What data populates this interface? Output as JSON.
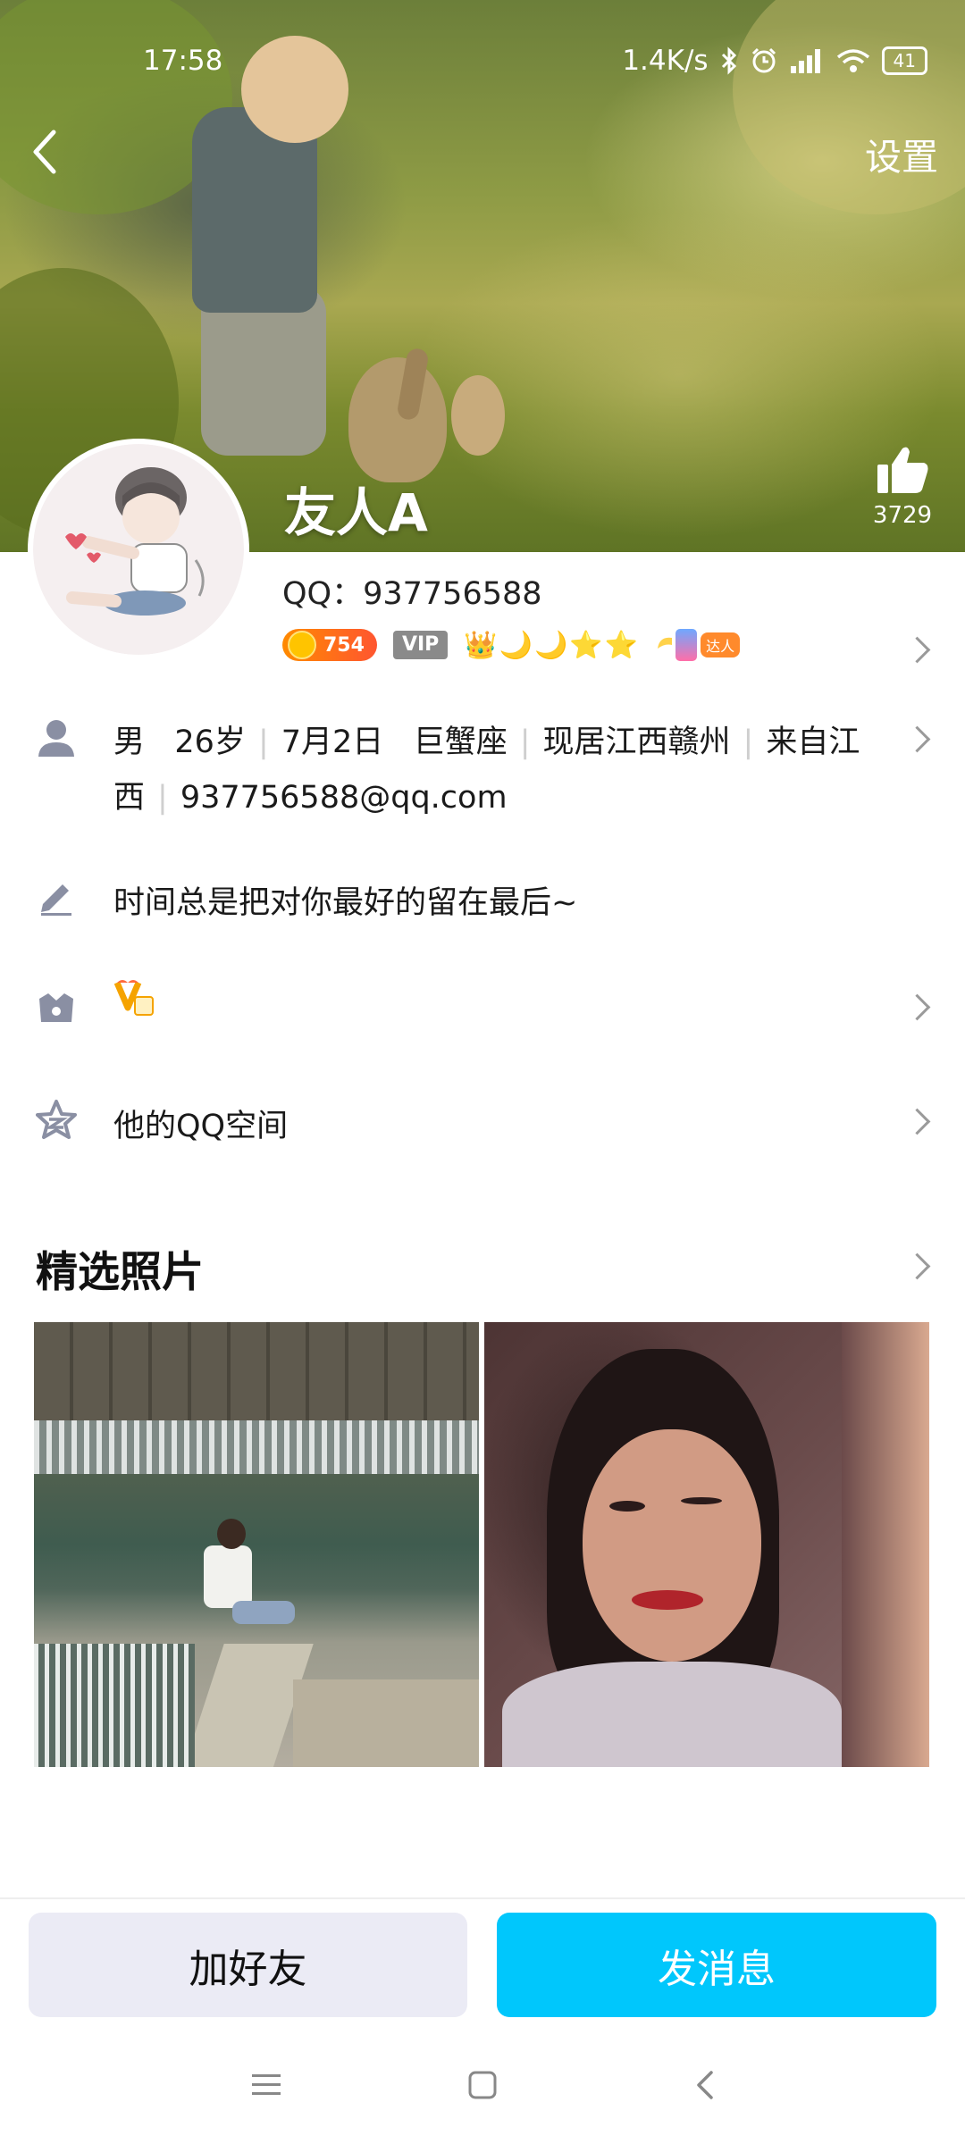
{
  "status_bar": {
    "time": "17:58",
    "network_speed": "1.4K/s",
    "battery": "41",
    "icons": [
      "bluetooth-icon",
      "alarm-icon",
      "signal-icon",
      "wifi-icon",
      "battery-icon"
    ]
  },
  "header": {
    "settings_label": "设置",
    "nickname": "友人A",
    "like_count": "3729"
  },
  "profile": {
    "qq_number": "QQ：937756588",
    "badges": {
      "points": "754",
      "vip": "VIP",
      "level_icons": "👑🌙🌙⭐⭐",
      "talent_tag": "达人"
    },
    "details": {
      "gender": "男",
      "age": "26岁",
      "birthday": "7月2日",
      "zodiac": "巨蟹座",
      "residence": "现居江西赣州",
      "hometown": "来自江西",
      "email": "937756588@qq.com"
    },
    "signature": "时间总是把对你最好的留在最后~",
    "qzone_label": "他的QQ空间"
  },
  "photos_section": {
    "title": "精选照片"
  },
  "actions": {
    "add_friend": "加好友",
    "send_message": "发消息"
  },
  "colors": {
    "accent": "#00c7fc",
    "secondary_button": "#ebebf5",
    "icon_gray": "#8a8fa3"
  }
}
